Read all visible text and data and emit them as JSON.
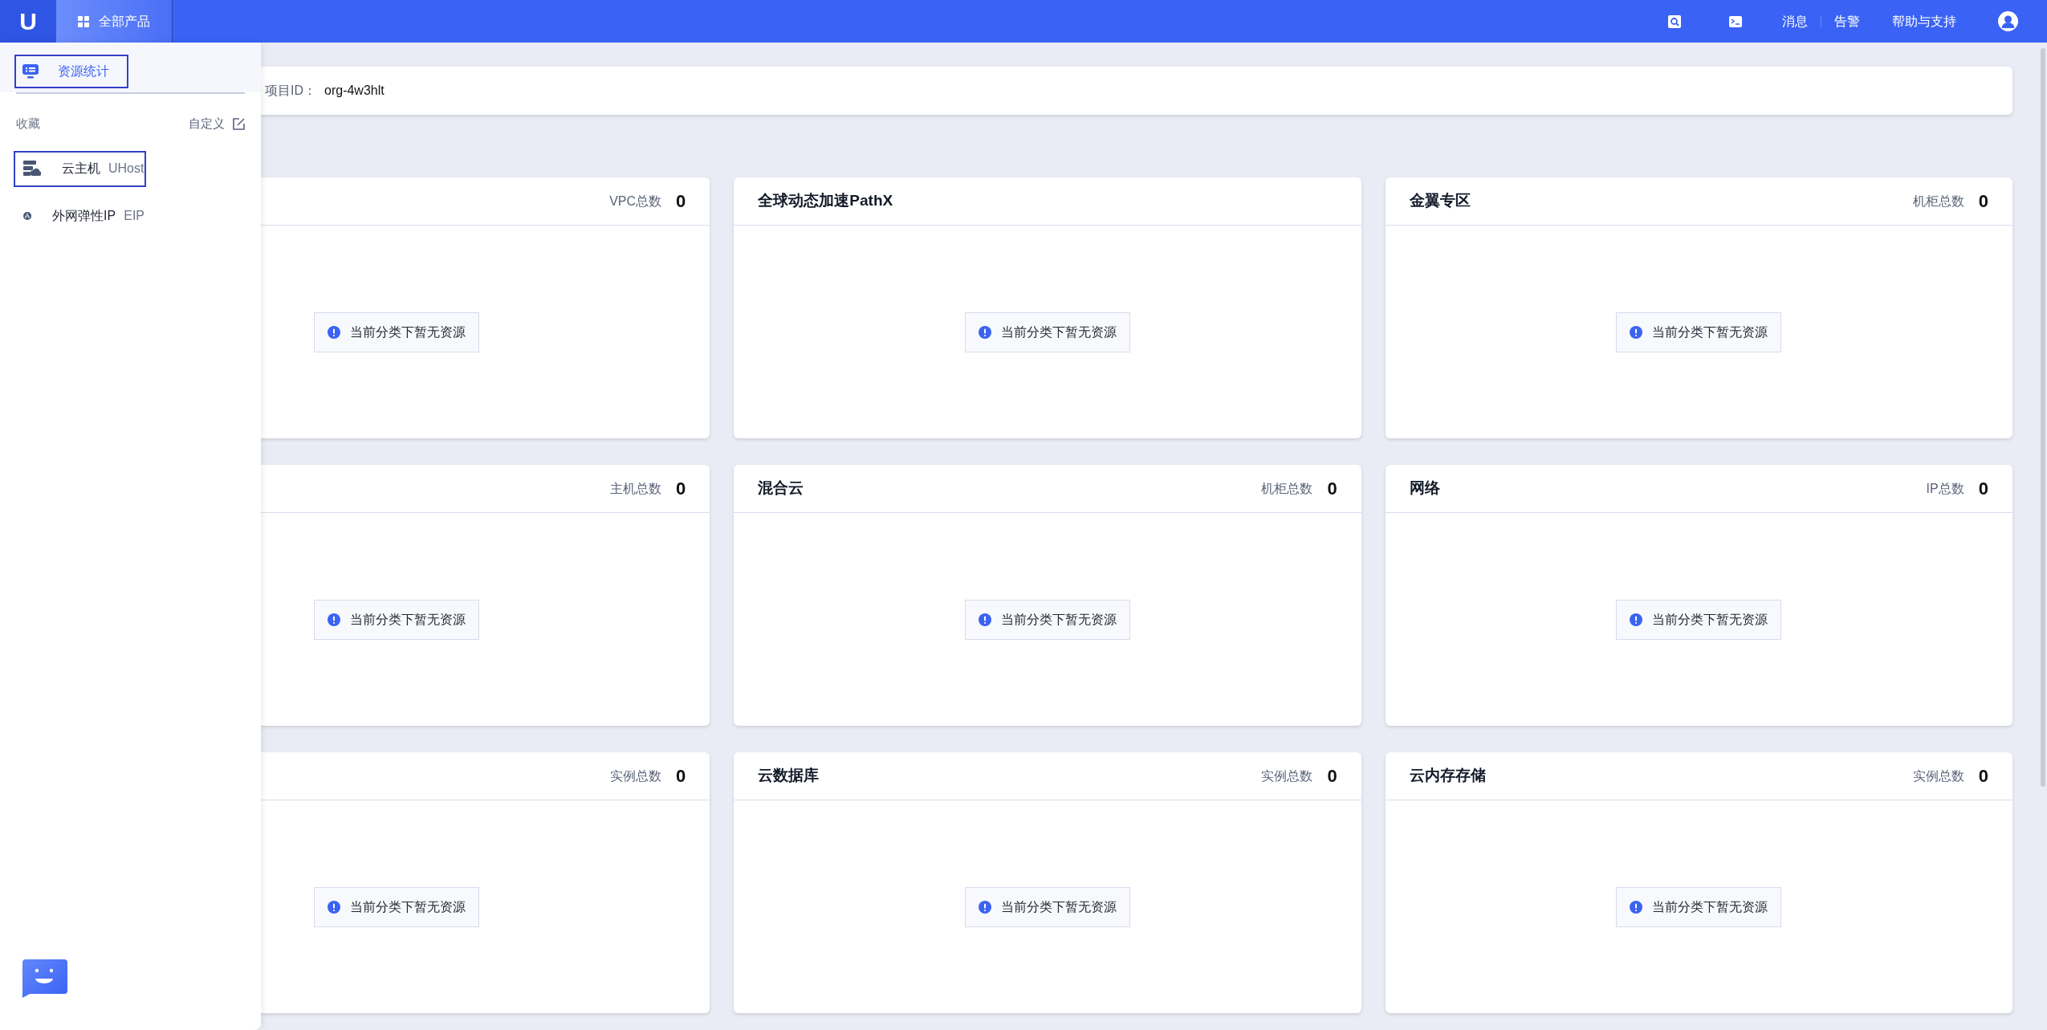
{
  "top_bar": {
    "logo": "U",
    "products_menu": "全部产品",
    "links": [
      "消息",
      "告警",
      "帮助与支持"
    ]
  },
  "sidebar": {
    "items": [
      {
        "label": "资源统计",
        "selected": true
      }
    ],
    "favorites_label": "收藏",
    "customize": "自定义",
    "favorites": [
      {
        "name": "云主机",
        "code": "UHost",
        "kind": "host"
      },
      {
        "name": "外网弹性IP",
        "code": "EIP",
        "kind": "eip"
      }
    ]
  },
  "project": {
    "label": "项目ID：",
    "value": "org-4w3hlt"
  },
  "cards": [
    {
      "count_label": "VPC总数",
      "count": "0",
      "empty_text": "当前分类下暂无资源"
    },
    {
      "title": "全球动态加速PathX",
      "empty_text": "当前分类下暂无资源"
    },
    {
      "title": "金翼专区",
      "count_label": "机柜总数",
      "count": "0",
      "empty_text": "当前分类下暂无资源"
    },
    {
      "count_label": "主机总数",
      "count": "0",
      "empty_text": "当前分类下暂无资源"
    },
    {
      "title": "混合云",
      "count_label": "机柜总数",
      "count": "0",
      "empty_text": "当前分类下暂无资源"
    },
    {
      "title": "网络",
      "count_label": "IP总数",
      "count": "0",
      "empty_text": "当前分类下暂无资源"
    },
    {
      "count_label": "实例总数",
      "count": "0",
      "empty_text": "当前分类下暂无资源"
    },
    {
      "title": "云数据库",
      "count_label": "实例总数",
      "count": "0",
      "empty_text": "当前分类下暂无资源"
    },
    {
      "title": "云内存存储",
      "count_label": "实例总数",
      "count": "0",
      "empty_text": "当前分类下暂无资源"
    }
  ]
}
